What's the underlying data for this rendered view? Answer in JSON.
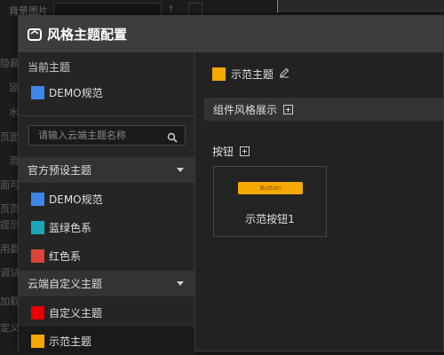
{
  "background": {
    "top_label": "背景图片",
    "left_labels": [
      "隐藏",
      "竖",
      "水",
      "页面",
      "滑",
      "面可消",
      "页页面",
      "提示招",
      "用委",
      "调试",
      "加载",
      "定义"
    ]
  },
  "modal": {
    "title": "风格主题配置",
    "left": {
      "current_label": "当前主题",
      "current_theme": {
        "name": "DEMO规范",
        "color": "#3f86e8"
      },
      "search_placeholder": "请输入云端主题名称",
      "preset_group": {
        "label": "官方预设主题",
        "items": [
          {
            "name": "DEMO规范",
            "color": "#3f86e8"
          },
          {
            "name": "蓝绿色系",
            "color": "#1aa6b7"
          },
          {
            "name": "红色系",
            "color": "#d9443a"
          }
        ]
      },
      "cloud_group": {
        "label": "云端自定义主题",
        "items": [
          {
            "name": "自定义主题",
            "color": "#e80000"
          },
          {
            "name": "示范主题",
            "color": "#f5a800"
          }
        ]
      }
    },
    "right": {
      "theme_name": "示范主题",
      "theme_color": "#f5a800",
      "component_section_label": "组件风格展示",
      "button_section_label": "按钮",
      "demo_button_text": "Button",
      "card_label": "示范按钮1"
    }
  }
}
